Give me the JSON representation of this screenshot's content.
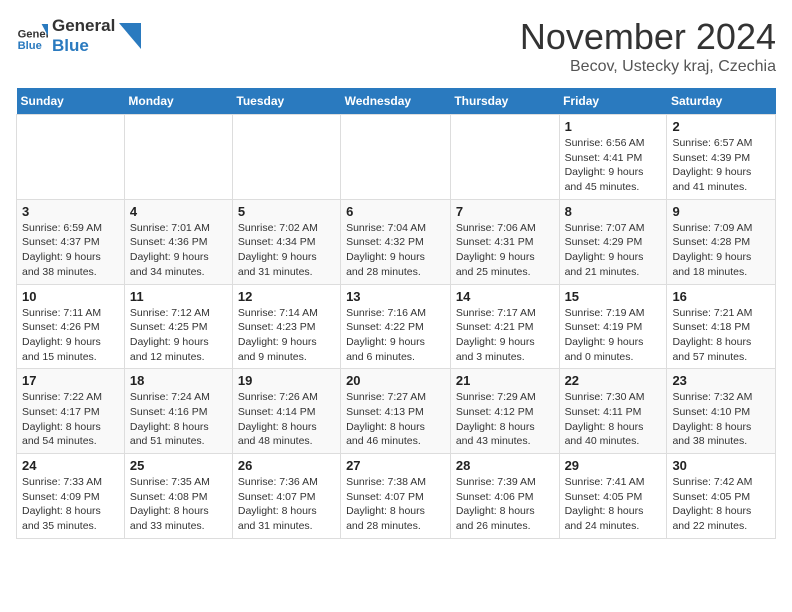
{
  "header": {
    "logo_general": "General",
    "logo_blue": "Blue",
    "month": "November 2024",
    "location": "Becov, Ustecky kraj, Czechia"
  },
  "columns": [
    "Sunday",
    "Monday",
    "Tuesday",
    "Wednesday",
    "Thursday",
    "Friday",
    "Saturday"
  ],
  "weeks": [
    {
      "days": [
        {
          "num": "",
          "info": ""
        },
        {
          "num": "",
          "info": ""
        },
        {
          "num": "",
          "info": ""
        },
        {
          "num": "",
          "info": ""
        },
        {
          "num": "",
          "info": ""
        },
        {
          "num": "1",
          "info": "Sunrise: 6:56 AM\nSunset: 4:41 PM\nDaylight: 9 hours and 45 minutes."
        },
        {
          "num": "2",
          "info": "Sunrise: 6:57 AM\nSunset: 4:39 PM\nDaylight: 9 hours and 41 minutes."
        }
      ]
    },
    {
      "days": [
        {
          "num": "3",
          "info": "Sunrise: 6:59 AM\nSunset: 4:37 PM\nDaylight: 9 hours and 38 minutes."
        },
        {
          "num": "4",
          "info": "Sunrise: 7:01 AM\nSunset: 4:36 PM\nDaylight: 9 hours and 34 minutes."
        },
        {
          "num": "5",
          "info": "Sunrise: 7:02 AM\nSunset: 4:34 PM\nDaylight: 9 hours and 31 minutes."
        },
        {
          "num": "6",
          "info": "Sunrise: 7:04 AM\nSunset: 4:32 PM\nDaylight: 9 hours and 28 minutes."
        },
        {
          "num": "7",
          "info": "Sunrise: 7:06 AM\nSunset: 4:31 PM\nDaylight: 9 hours and 25 minutes."
        },
        {
          "num": "8",
          "info": "Sunrise: 7:07 AM\nSunset: 4:29 PM\nDaylight: 9 hours and 21 minutes."
        },
        {
          "num": "9",
          "info": "Sunrise: 7:09 AM\nSunset: 4:28 PM\nDaylight: 9 hours and 18 minutes."
        }
      ]
    },
    {
      "days": [
        {
          "num": "10",
          "info": "Sunrise: 7:11 AM\nSunset: 4:26 PM\nDaylight: 9 hours and 15 minutes."
        },
        {
          "num": "11",
          "info": "Sunrise: 7:12 AM\nSunset: 4:25 PM\nDaylight: 9 hours and 12 minutes."
        },
        {
          "num": "12",
          "info": "Sunrise: 7:14 AM\nSunset: 4:23 PM\nDaylight: 9 hours and 9 minutes."
        },
        {
          "num": "13",
          "info": "Sunrise: 7:16 AM\nSunset: 4:22 PM\nDaylight: 9 hours and 6 minutes."
        },
        {
          "num": "14",
          "info": "Sunrise: 7:17 AM\nSunset: 4:21 PM\nDaylight: 9 hours and 3 minutes."
        },
        {
          "num": "15",
          "info": "Sunrise: 7:19 AM\nSunset: 4:19 PM\nDaylight: 9 hours and 0 minutes."
        },
        {
          "num": "16",
          "info": "Sunrise: 7:21 AM\nSunset: 4:18 PM\nDaylight: 8 hours and 57 minutes."
        }
      ]
    },
    {
      "days": [
        {
          "num": "17",
          "info": "Sunrise: 7:22 AM\nSunset: 4:17 PM\nDaylight: 8 hours and 54 minutes."
        },
        {
          "num": "18",
          "info": "Sunrise: 7:24 AM\nSunset: 4:16 PM\nDaylight: 8 hours and 51 minutes."
        },
        {
          "num": "19",
          "info": "Sunrise: 7:26 AM\nSunset: 4:14 PM\nDaylight: 8 hours and 48 minutes."
        },
        {
          "num": "20",
          "info": "Sunrise: 7:27 AM\nSunset: 4:13 PM\nDaylight: 8 hours and 46 minutes."
        },
        {
          "num": "21",
          "info": "Sunrise: 7:29 AM\nSunset: 4:12 PM\nDaylight: 8 hours and 43 minutes."
        },
        {
          "num": "22",
          "info": "Sunrise: 7:30 AM\nSunset: 4:11 PM\nDaylight: 8 hours and 40 minutes."
        },
        {
          "num": "23",
          "info": "Sunrise: 7:32 AM\nSunset: 4:10 PM\nDaylight: 8 hours and 38 minutes."
        }
      ]
    },
    {
      "days": [
        {
          "num": "24",
          "info": "Sunrise: 7:33 AM\nSunset: 4:09 PM\nDaylight: 8 hours and 35 minutes."
        },
        {
          "num": "25",
          "info": "Sunrise: 7:35 AM\nSunset: 4:08 PM\nDaylight: 8 hours and 33 minutes."
        },
        {
          "num": "26",
          "info": "Sunrise: 7:36 AM\nSunset: 4:07 PM\nDaylight: 8 hours and 31 minutes."
        },
        {
          "num": "27",
          "info": "Sunrise: 7:38 AM\nSunset: 4:07 PM\nDaylight: 8 hours and 28 minutes."
        },
        {
          "num": "28",
          "info": "Sunrise: 7:39 AM\nSunset: 4:06 PM\nDaylight: 8 hours and 26 minutes."
        },
        {
          "num": "29",
          "info": "Sunrise: 7:41 AM\nSunset: 4:05 PM\nDaylight: 8 hours and 24 minutes."
        },
        {
          "num": "30",
          "info": "Sunrise: 7:42 AM\nSunset: 4:05 PM\nDaylight: 8 hours and 22 minutes."
        }
      ]
    }
  ]
}
